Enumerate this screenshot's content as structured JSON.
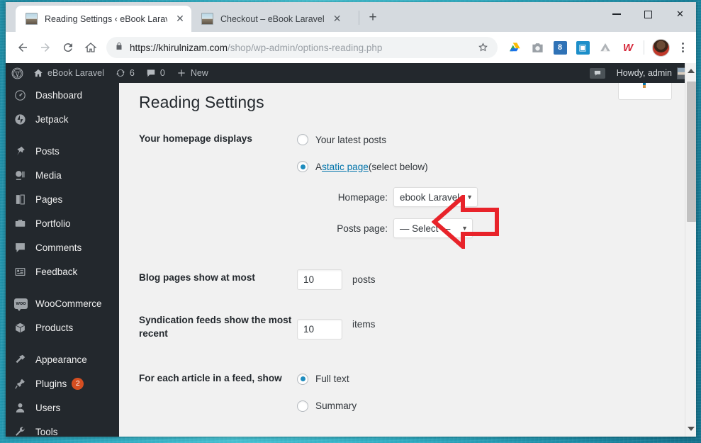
{
  "browser": {
    "tabs": [
      {
        "title": "Reading Settings ‹ eBook Laravel",
        "favicon": "site-favicon",
        "active": true,
        "close": "✕"
      },
      {
        "title": "Checkout – eBook Laravel",
        "favicon": "site-favicon",
        "active": false,
        "close": "✕"
      }
    ],
    "new_tab_label": "+",
    "window_controls": {
      "minimize": "minimize-icon",
      "maximize": "maximize-icon",
      "close": "✕"
    },
    "toolbar": {
      "back": "←",
      "forward": "→",
      "reload": "⟳",
      "home": "⌂",
      "lock": "lock-icon",
      "url_host": "https://khirulnizam.com",
      "url_path": "/shop/wp-admin/options-reading.php",
      "star": "☆",
      "extensions": [
        {
          "name": "google-drive-icon",
          "glyph": "▲"
        },
        {
          "name": "camera-icon",
          "glyph": "📷"
        },
        {
          "name": "blue-8-extension-icon",
          "glyph": "8"
        },
        {
          "name": "contact-card-extension-icon",
          "glyph": "▣"
        },
        {
          "name": "gray-drive-icon",
          "glyph": "▲"
        },
        {
          "name": "red-w-extension-icon",
          "glyph": "W"
        }
      ],
      "profile_avatar": "user-avatar",
      "menu": "⋮"
    }
  },
  "adminbar": {
    "wp_logo": "wordpress-logo",
    "site_name": "eBook Laravel",
    "updates_count": "6",
    "comments_count": "0",
    "new_label": "New",
    "howdy": "Howdy, admin",
    "howdy_avatar": "admin-avatar",
    "notification_icon": "comment-bubble-icon"
  },
  "sidebar": {
    "items": [
      {
        "label": "Dashboard",
        "icon": "dashboard-icon",
        "gap_before": false
      },
      {
        "label": "Jetpack",
        "icon": "jetpack-icon",
        "gap_before": false
      },
      {
        "label": "Posts",
        "icon": "pin-icon",
        "gap_before": true
      },
      {
        "label": "Media",
        "icon": "media-icon",
        "gap_before": false
      },
      {
        "label": "Pages",
        "icon": "pages-icon",
        "gap_before": false
      },
      {
        "label": "Portfolio",
        "icon": "portfolio-icon",
        "gap_before": false
      },
      {
        "label": "Comments",
        "icon": "comments-icon",
        "gap_before": false
      },
      {
        "label": "Feedback",
        "icon": "feedback-icon",
        "gap_before": false
      },
      {
        "label": "WooCommerce",
        "icon": "woocommerce-icon",
        "gap_before": true
      },
      {
        "label": "Products",
        "icon": "products-icon",
        "gap_before": false
      },
      {
        "label": "Appearance",
        "icon": "appearance-icon",
        "gap_before": true
      },
      {
        "label": "Plugins",
        "icon": "plugins-icon",
        "badge": "2",
        "gap_before": false
      },
      {
        "label": "Users",
        "icon": "users-icon",
        "gap_before": false
      },
      {
        "label": "Tools",
        "icon": "tools-icon",
        "gap_before": false
      }
    ]
  },
  "main": {
    "page_title": "Reading Settings",
    "homepage_displays": {
      "label": "Your homepage displays",
      "option_latest": "Your latest posts",
      "option_static_prefix": "A ",
      "option_static_link": "static page",
      "option_static_suffix": " (select below)",
      "selected": "static"
    },
    "homepage_select": {
      "label": "Homepage:",
      "value": "ebook Laravel",
      "caret": "▼"
    },
    "posts_page_select": {
      "label": "Posts page:",
      "value": "— Select —",
      "caret": "▼"
    },
    "blog_pages": {
      "label": "Blog pages show at most",
      "value": "10",
      "unit": "posts"
    },
    "syndication_feeds": {
      "label": "Syndication feeds show the most recent",
      "value": "10",
      "unit": "items"
    },
    "feed_article": {
      "label": "For each article in a feed, show",
      "option_full": "Full text",
      "option_summary": "Summary",
      "selected": "full"
    }
  },
  "annotation": {
    "arrow": "red-left-arrow",
    "color": "#e8232a"
  },
  "scrollbar": {
    "up": "▲",
    "down": "▼"
  }
}
